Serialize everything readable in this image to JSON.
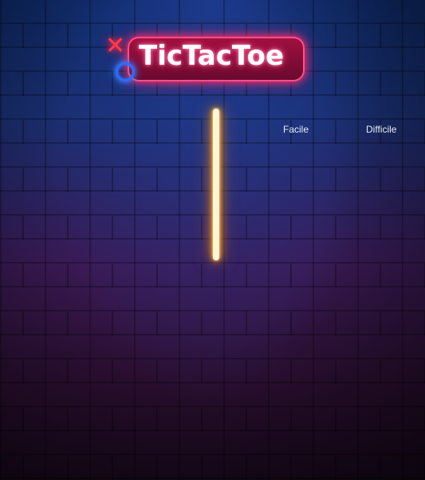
{
  "logo": {
    "text": "TicTacToe",
    "x_glyph": "✕",
    "icons": [
      "x-mark-icon",
      "o-ring-icon"
    ]
  },
  "difficulty": {
    "options": [
      "Facile",
      "Difficile"
    ]
  },
  "colors": {
    "logo_plate": "#a01040",
    "logo_glow": "#ff2a6a",
    "x_mark": "#ff3b4e",
    "o_ring": "#2f6bff",
    "neon_bar": "#ffae2a",
    "option_text": "#e6ecf5"
  }
}
